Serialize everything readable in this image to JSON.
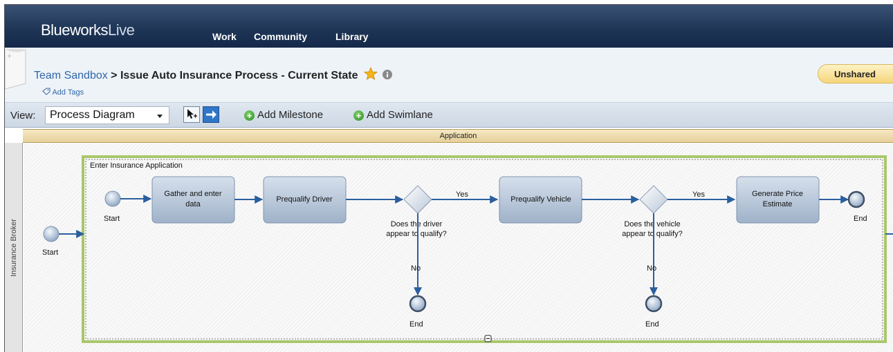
{
  "nav": {
    "logo_part1": "Blueworks",
    "logo_part2": "Live",
    "links": [
      "Work",
      "Community",
      "Library"
    ]
  },
  "header": {
    "breadcrumb_link": "Team Sandbox",
    "breadcrumb_sep": " > ",
    "title": "Issue Auto Insurance Process - Current State",
    "add_tags": "Add Tags",
    "share_button": "Unshared"
  },
  "toolbar": {
    "view_label": "View:",
    "view_value": "Process Diagram",
    "add_milestone": "Add Milestone",
    "add_swimlane": "Add Swimlane"
  },
  "diagram": {
    "milestone": "Application",
    "swimlane": "Insurance Broker",
    "subprocess_title": "Enter Insurance Application",
    "outer_start": "Start",
    "start": "Start",
    "activities": [
      "Gather and enter",
      "data",
      "Prequalify Driver",
      "Prequalify Vehicle",
      "Generate Price",
      "Estimate"
    ],
    "gateway1": [
      "Does the driver",
      "appear to qualify?"
    ],
    "gateway2": [
      "Does the vehicle",
      "appear to qualify?"
    ],
    "yes": "Yes",
    "no": "No",
    "end": "End"
  },
  "colors": {
    "nav_bg": "#1f3657",
    "accent_link": "#2f66a8",
    "subprocess_border": "#9bbd5a",
    "task_fill": "#b7c6d9",
    "flow_line": "#2a5f9e"
  }
}
